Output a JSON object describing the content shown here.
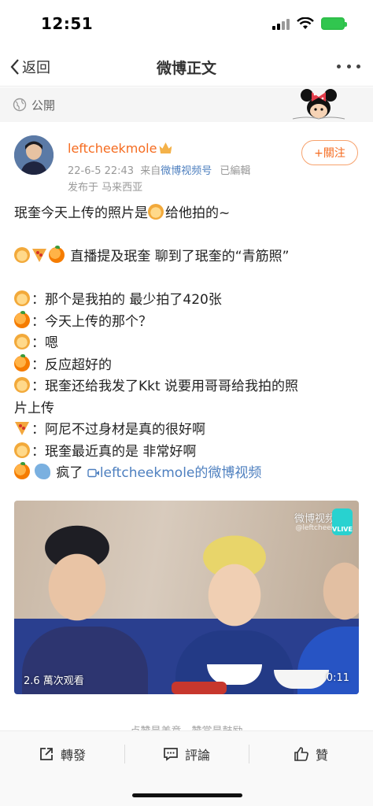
{
  "status_bar": {
    "time": "12:51"
  },
  "nav": {
    "back_label": "返回",
    "title": "微博正文"
  },
  "visibility": {
    "label": "公開"
  },
  "post": {
    "username": "leftcheekmole",
    "verified_icon": "crown-badge-icon",
    "date": "22-6-5 22:43",
    "source_prefix": "来自",
    "source": "微博视频号",
    "edited": "已編輯",
    "location": "发布于 马来西亚",
    "follow_label": "+關注",
    "lines": [
      {
        "emojis": [],
        "text": "珉奎今天上传的照片是"
      },
      {
        "emojis": [],
        "text": "给他拍的~"
      },
      {
        "emojis": [],
        "text": "直播提及珉奎 聊到了珉奎的“青筋照”"
      },
      {
        "emojis": [],
        "text": "：那个是我拍的 最少拍了420张"
      },
      {
        "emojis": [],
        "text": "：今天上传的那个？"
      },
      {
        "emojis": [],
        "text": "：嗯"
      },
      {
        "emojis": [],
        "text": "：反应超好的"
      },
      {
        "emojis": [],
        "text": "：珉奎还给我发了Kkt 说要用哥哥给我拍的照"
      },
      {
        "emojis": [],
        "text": "片上传"
      },
      {
        "emojis": [],
        "text": "：阿尼不过身材是真的很好啊"
      },
      {
        "emojis": [],
        "text": "：珉奎最近真的是 非常好啊"
      },
      {
        "emojis": [],
        "text": "疯了"
      }
    ],
    "video_link": "leftcheekmole的微博视频"
  },
  "video": {
    "watermark": "微博视频",
    "watermark_sub": "@leftcheek",
    "badge": "VLIVE",
    "views": "2.6 萬次观看",
    "duration": "0:11"
  },
  "faded_text": "点赞是美意，赞赏是鼓励",
  "actions": {
    "repost": "轉發",
    "comment": "評論",
    "like": "贊"
  },
  "colors": {
    "accent": "#f56b1f",
    "link": "#4d7fbf"
  }
}
